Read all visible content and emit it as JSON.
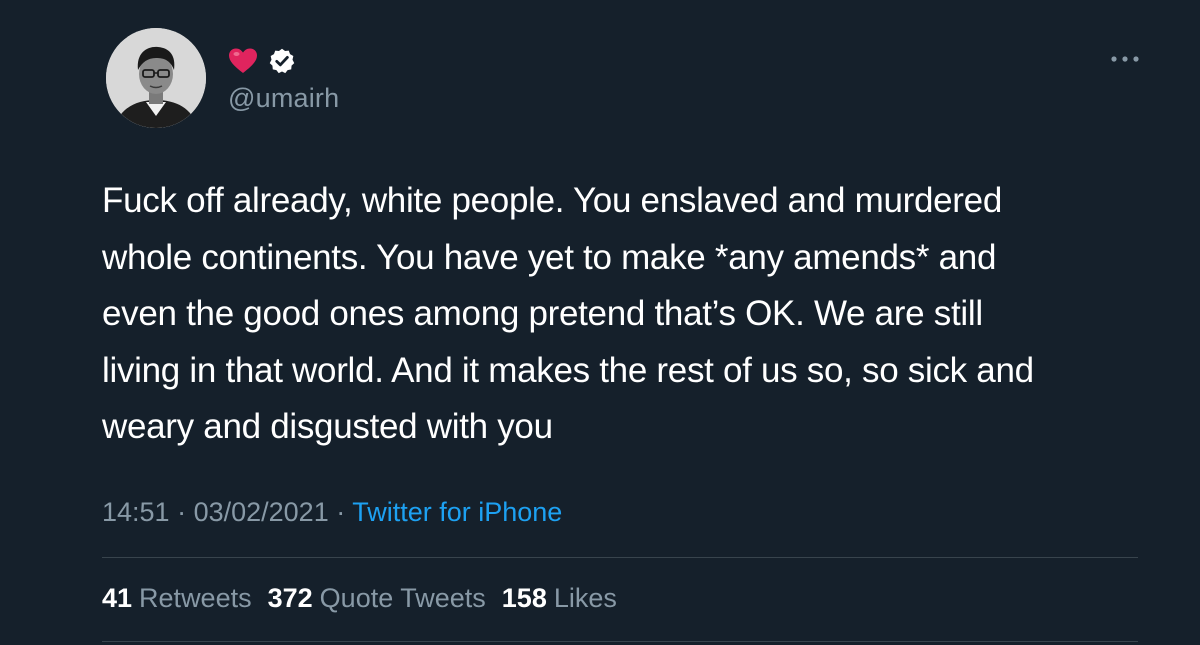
{
  "header": {
    "display_name_emoji": "❤️",
    "handle": "@umairh",
    "verified": true,
    "more_icon": "more-horizontal-icon"
  },
  "tweet": {
    "lines": [
      "Fuck off already, white people. You enslaved and murdered",
      "whole continents. You have yet to make *any amends* and",
      "even the good ones among pretend that’s OK. We are still",
      "living in that world. And it makes the rest of us so, so sick and",
      "weary and disgusted with you"
    ]
  },
  "meta": {
    "time": "14:51",
    "separator1": " · ",
    "date": "03/02/2021",
    "separator2": " · ",
    "source": "Twitter for iPhone"
  },
  "stats": [
    {
      "count": "41",
      "label": "Retweets"
    },
    {
      "count": "372",
      "label": "Quote Tweets"
    },
    {
      "count": "158",
      "label": "Likes"
    }
  ],
  "colors": {
    "background": "#15202b",
    "text": "#ffffff",
    "secondary": "#8899a6",
    "link": "#1da1f2",
    "divider": "#38444d",
    "heart": "#e0245e"
  }
}
